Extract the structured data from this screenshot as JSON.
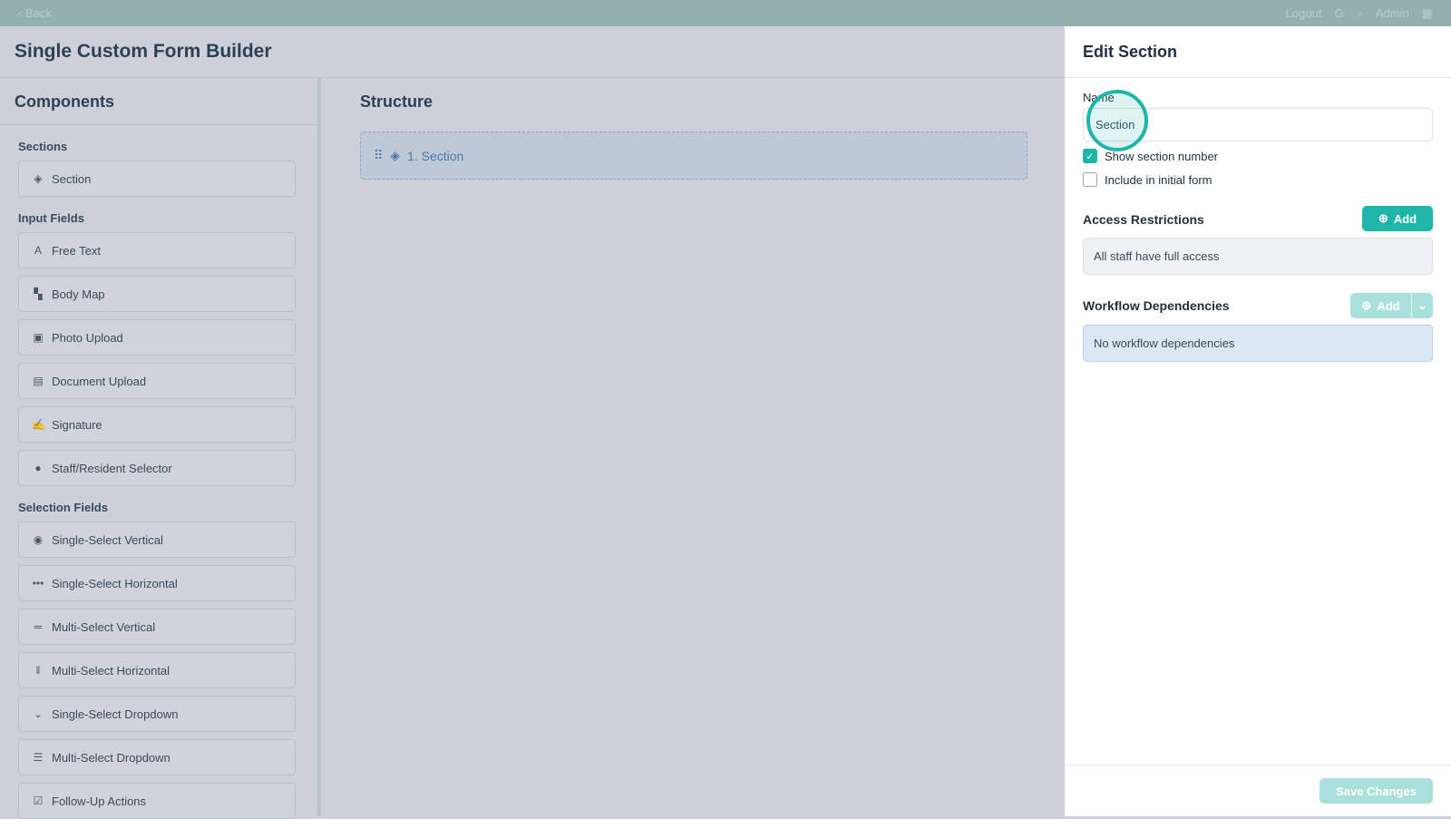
{
  "topbar": {
    "back": "‹ Back",
    "logout": "Logout",
    "user": "Admin"
  },
  "header": {
    "title": "Single Custom Form Builder"
  },
  "components": {
    "title": "Components",
    "groups": [
      {
        "label": "Sections",
        "items": [
          {
            "label": "Section",
            "icon": "layers-icon"
          }
        ]
      },
      {
        "label": "Input Fields",
        "items": [
          {
            "label": "Free Text",
            "icon": "text-icon"
          },
          {
            "label": "Body Map",
            "icon": "body-map-icon"
          },
          {
            "label": "Photo Upload",
            "icon": "image-icon"
          },
          {
            "label": "Document Upload",
            "icon": "file-icon"
          },
          {
            "label": "Signature",
            "icon": "signature-icon"
          },
          {
            "label": "Staff/Resident Selector",
            "icon": "user-icon"
          }
        ]
      },
      {
        "label": "Selection Fields",
        "items": [
          {
            "label": "Single-Select Vertical",
            "icon": "radio-icon"
          },
          {
            "label": "Single-Select Horizontal",
            "icon": "dots-icon"
          },
          {
            "label": "Multi-Select Vertical",
            "icon": "equals-icon"
          },
          {
            "label": "Multi-Select Horizontal",
            "icon": "bars-icon"
          },
          {
            "label": "Single-Select Dropdown",
            "icon": "chevron-down-icon"
          },
          {
            "label": "Multi-Select Dropdown",
            "icon": "list-icon"
          },
          {
            "label": "Follow-Up Actions",
            "icon": "checkbox-icon"
          }
        ]
      }
    ]
  },
  "structure": {
    "title": "Structure",
    "section": "1. Section"
  },
  "panel": {
    "title": "Edit Section",
    "name_label": "Name",
    "name_value": "Section",
    "show_number": "Show section number",
    "include_initial": "Include in initial form",
    "access_title": "Access Restrictions",
    "add": "Add",
    "access_text": "All staff have full access",
    "workflow_title": "Workflow Dependencies",
    "workflow_text": "No workflow dependencies",
    "save": "Save Changes"
  }
}
